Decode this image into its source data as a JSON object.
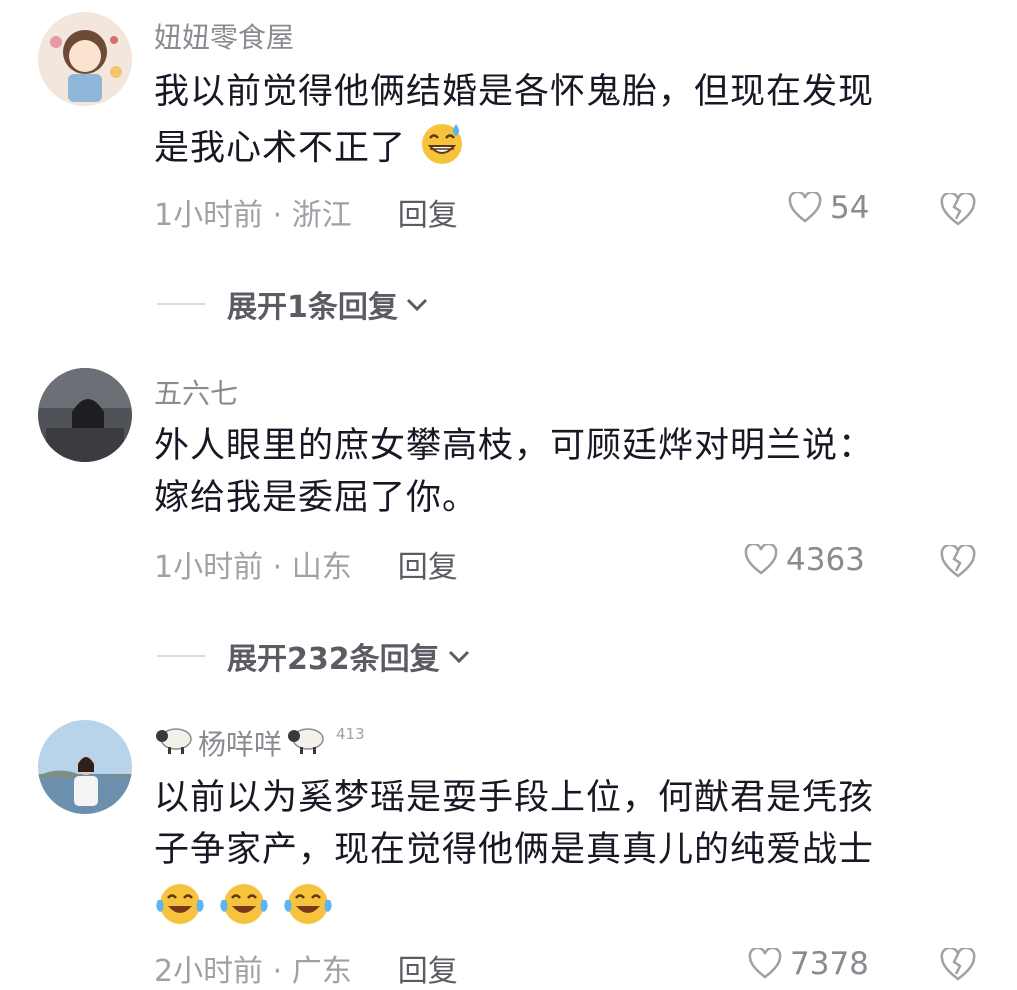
{
  "comments": [
    {
      "username": "妞妞零食屋",
      "text_line1": "我以前觉得他俩结婚是各怀鬼胎，但现在发现",
      "text_line2": "是我心术不正了",
      "meta": "1小时前 · 浙江",
      "reply_label": "回复",
      "likes": "54",
      "expand_label": "展开1条回复",
      "emoji": "grinning-sweat-emoji"
    },
    {
      "username": "五六七",
      "text_line1": "外人眼里的庶女攀高枝，可顾廷烨对明兰说：",
      "text_line2": "嫁给我是委屈了你。",
      "meta": "1小时前 · 山东",
      "reply_label": "回复",
      "likes": "4363",
      "expand_label": "展开232条回复"
    },
    {
      "username": "杨咩咩",
      "level": "413",
      "text_line1": "以前以为奚梦瑶是耍手段上位，何猷君是凭孩",
      "text_line2": "子争家产，现在觉得他俩是真真儿的纯爱战士",
      "meta": "2小时前 · 广东",
      "reply_label": "回复",
      "likes": "7378",
      "emoji": "tears-of-joy-emoji",
      "emoji_count": 3
    }
  ],
  "icons": {
    "like": "heart-outline-icon",
    "dislike": "broken-heart-icon",
    "expand": "chevron-down-icon",
    "name_decoration": "sheep-icon"
  },
  "colors": {
    "text": "#161823",
    "secondary": "#8a8b91",
    "meta": "#a0a1a6",
    "reply": "#5b5c63",
    "emoji": "#f7c33c"
  }
}
